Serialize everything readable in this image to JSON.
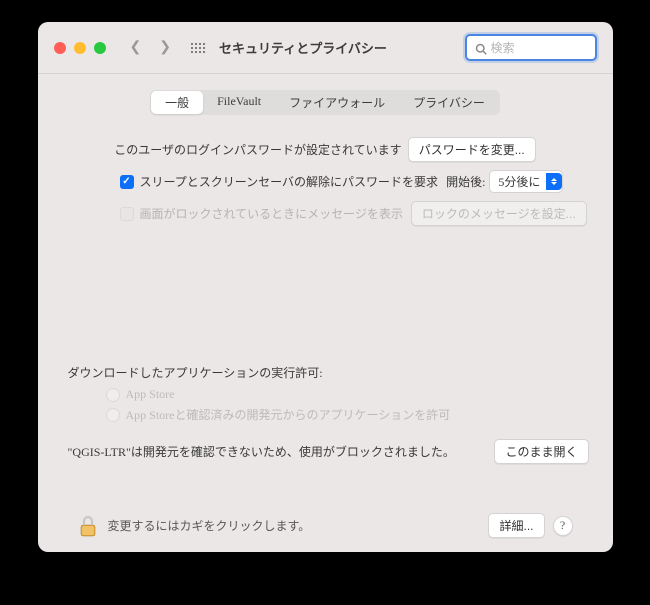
{
  "window": {
    "title": "セキュリティとプライバシー"
  },
  "search": {
    "placeholder": "検索"
  },
  "tabs": {
    "general": "一般",
    "filevault": "FileVault",
    "firewall": "ファイアウォール",
    "privacy": "プライバシー"
  },
  "rows": {
    "password_set": "このユーザのログインパスワードが設定されています",
    "change_password": "パスワードを変更...",
    "require_password": "スリープとスクリーンセーバの解除にパスワードを要求",
    "after_label": "開始後:",
    "after_value": "5分後に",
    "lock_message_label": "画面がロックされているときにメッセージを表示",
    "lock_message_btn": "ロックのメッセージを設定..."
  },
  "downloads": {
    "section_label": "ダウンロードしたアプリケーションの実行許可:",
    "option1": "App Store",
    "option2": "App Storeと確認済みの開発元からのアプリケーションを許可",
    "blocked_text": "\"QGIS-LTR\"は開発元を確認できないため、使用がブロックされました。",
    "open_anyway": "このまま開く"
  },
  "footer": {
    "lock_text": "変更するにはカギをクリックします。",
    "details": "詳細...",
    "help": "?"
  }
}
